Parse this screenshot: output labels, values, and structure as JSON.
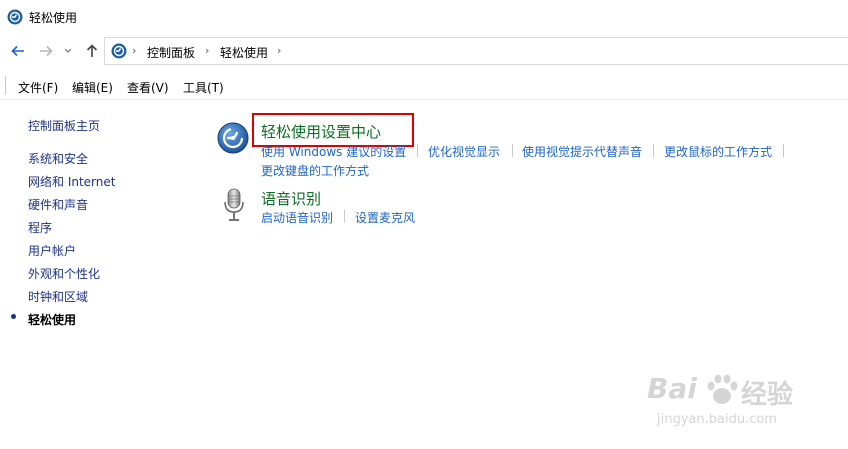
{
  "window": {
    "title": "轻松使用"
  },
  "address": {
    "crumbs": [
      "控制面板",
      "轻松使用"
    ]
  },
  "menu": [
    "文件(F)",
    "编辑(E)",
    "查看(V)",
    "工具(T)"
  ],
  "sidebar": {
    "items": [
      "控制面板主页",
      "系统和安全",
      "网络和 Internet",
      "硬件和声音",
      "程序",
      "用户帐户",
      "外观和个性化",
      "时钟和区域",
      "轻松使用"
    ]
  },
  "categories": [
    {
      "title": "轻松使用设置中心",
      "links": [
        "使用 Windows 建议的设置",
        "优化视觉显示",
        "使用视觉提示代替声音",
        "更改鼠标的工作方式",
        "更改键盘的工作方式"
      ]
    },
    {
      "title": "语音识别",
      "links": [
        "启动语音识别",
        "设置麦克风"
      ]
    }
  ],
  "watermark": {
    "brand": "Bai",
    "brand2": "经验",
    "url": "jingyan.baidu.com"
  },
  "colors": {
    "accent": "#1e64c8",
    "category": "#0c6e24",
    "highlight": "#e00000"
  }
}
